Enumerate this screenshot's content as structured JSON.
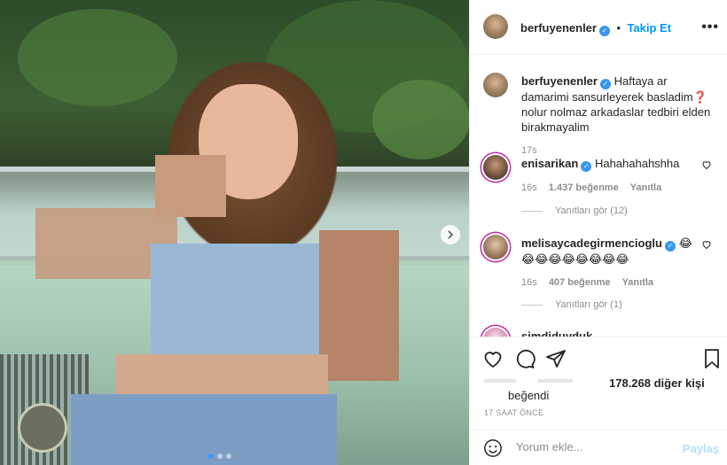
{
  "post": {
    "username": "berfuyenenler",
    "follow_label": "Takip Et",
    "more_label": "•••",
    "image_alt": "photo",
    "caption": "Haftaya ar damarimi sansurleyerek basladim❓ nolur nolmaz arkadaslar tedbiri elden birakmayalim",
    "caption_time": "17s"
  },
  "comments": [
    {
      "username": "enisarikan",
      "text": "Hahahahahshha",
      "time": "16s",
      "likes": "1.437 beğenme",
      "reply_label": "Yanıtla",
      "view_replies": "Yanıtları gör (12)"
    },
    {
      "username": "melisaycadegirmencioglu",
      "text": "😂 😂😂😂😂😂😂😂😂",
      "time": "16s",
      "likes": "407 beğenme",
      "reply_label": "Yanıtla",
      "view_replies": "Yanıtları gör (1)"
    },
    {
      "username": "simdiduyduk"
    }
  ],
  "likes_summary": {
    "count": "178.268 diğer kişi",
    "liked_label": "beğendi"
  },
  "timestamp": "17 SAAT ÖNCE",
  "add_comment": {
    "placeholder": "Yorum ekle...",
    "post_label": "Paylaş"
  },
  "colors": {
    "accent": "#0095f6",
    "verified": "#3897f0",
    "muted": "#8e8e8e"
  }
}
